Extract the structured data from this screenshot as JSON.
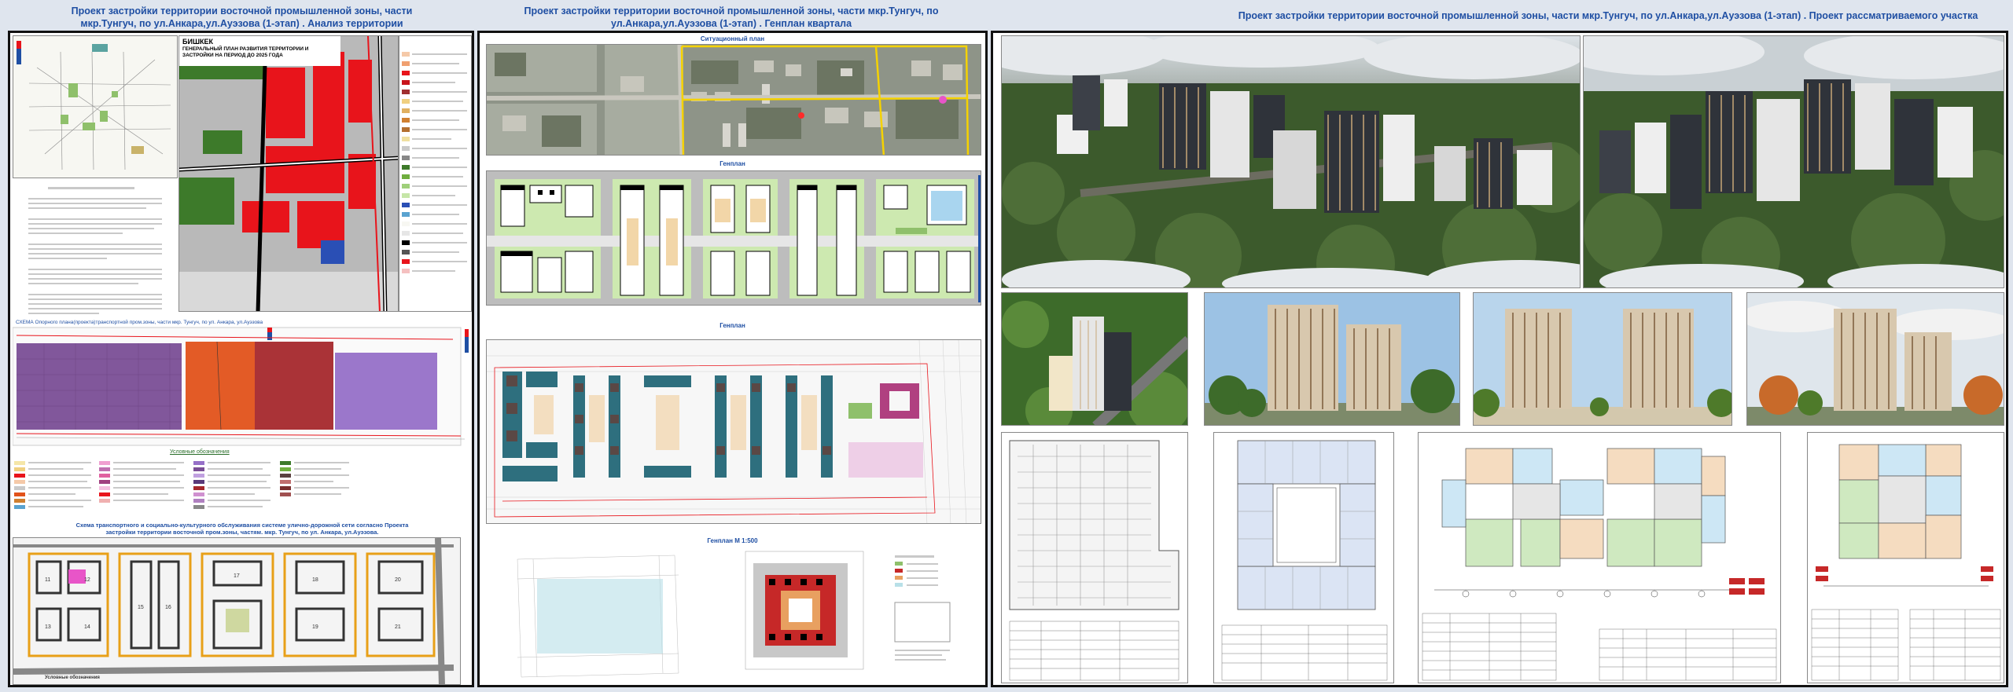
{
  "titles": {
    "panel1": "Проект застройки территории восточной промышленной зоны, части мкр.Тунгуч, по ул.Анкара,ул.Ауэзова (1-этап) . Анализ территории",
    "panel2": "Проект застройки территории восточной промышленной зоны, части мкр.Тунгуч, по ул.Анкара,ул.Ауэзова (1-этап) . Генплан  квартала",
    "panel3": "Проект застройки территории восточной промышленной зоны, части мкр.Тунгуч, по ул.Анкара,ул.Ауэзова (1-этап) . Проект рассматриваемого участка"
  },
  "panel1": {
    "genplan_city": "БИШКЕК",
    "genplan_title": "ГЕНЕРАЛЬНЫЙ ПЛАН РАЗВИТИЯ ТЕРРИТОРИИ И ЗАСТРОЙКИ НА ПЕРИОД ДО 2025 ГОДА",
    "scheme_title": "СХЕМА Опорного плана(проекта)транспортной пром.зоны, части мкр. Тунгуч, по ул. Анкара, ул.Ауэзова",
    "legend_title": "Условные обозначения",
    "transport_title": "Схема транспортного и социально-культурного обслуживания системе улично-дорожной сети согласно Проекта застройки территории восточной пром.зоны, частям. мкр. Тунгуч, по ул. Анкара, ул.Ауэзова.",
    "transport_legend": "Условные обозначения"
  },
  "panel2": {
    "situation_label": "Ситуационный план",
    "genplan_label": "Генплан",
    "genplan2_label": "Генплан",
    "genplan_scale_label": "Генплан М 1:500"
  },
  "colors": {
    "title_blue": "#1f4fa3",
    "zone_red": "#e8141b",
    "zone_purple": "#7a4e96",
    "zone_orange": "#e2521a",
    "zone_dark_red": "#a5282c",
    "zone_violet": "#9670c8",
    "forest_green": "#3c5a2c"
  }
}
